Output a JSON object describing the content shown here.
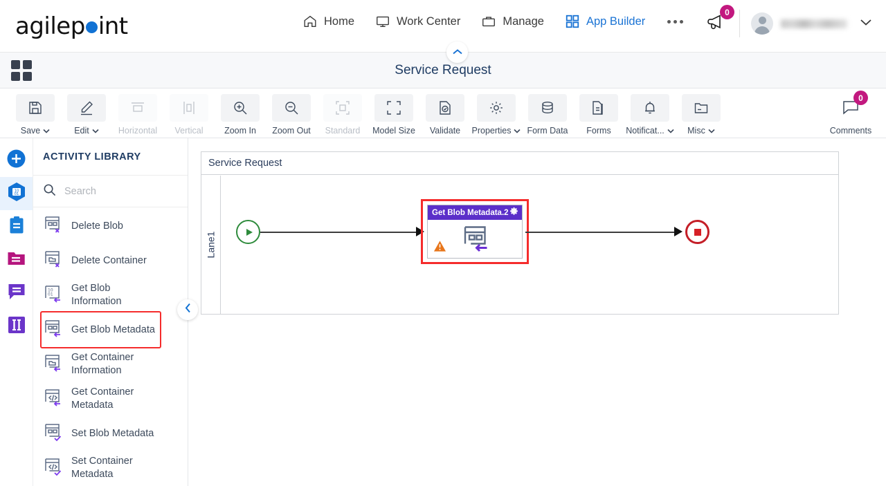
{
  "brand": {
    "name_part1": "agilep",
    "name_part2": "int",
    "dot_color": "#1172d4"
  },
  "topnav": {
    "items": [
      {
        "label": "Home",
        "icon": "home-icon",
        "active": false
      },
      {
        "label": "Work Center",
        "icon": "monitor-icon",
        "active": false
      },
      {
        "label": "Manage",
        "icon": "briefcase-icon",
        "active": false
      },
      {
        "label": "App Builder",
        "icon": "grid-icon",
        "active": true
      }
    ],
    "overflow_icon": "ellipsis-icon",
    "announcements": {
      "icon": "megaphone-icon",
      "badge": "0",
      "badge_color": "#c2187f"
    },
    "user": {
      "avatar": "avatar-icon",
      "name": "",
      "chevron": "chevron-down-icon"
    }
  },
  "titlebar": {
    "apps_icon": "apps-grid-icon",
    "title": "Service Request",
    "collapse_icon": "chevron-up-icon"
  },
  "toolbar": {
    "buttons": [
      {
        "label": "Save",
        "icon": "floppy-disk-icon",
        "caret": true,
        "disabled": false
      },
      {
        "label": "Edit",
        "icon": "pencil-icon",
        "caret": true,
        "disabled": false
      },
      {
        "label": "Horizontal",
        "icon": "align-horizontal-icon",
        "caret": false,
        "disabled": true
      },
      {
        "label": "Vertical",
        "icon": "align-vertical-icon",
        "caret": false,
        "disabled": true
      },
      {
        "label": "Zoom In",
        "icon": "zoom-in-icon",
        "caret": false,
        "disabled": false
      },
      {
        "label": "Zoom Out",
        "icon": "zoom-out-icon",
        "caret": false,
        "disabled": false
      },
      {
        "label": "Standard",
        "icon": "fit-standard-icon",
        "caret": false,
        "disabled": true
      },
      {
        "label": "Model Size",
        "icon": "model-size-icon",
        "caret": false,
        "disabled": false
      },
      {
        "label": "Validate",
        "icon": "validate-check-icon",
        "caret": false,
        "disabled": false
      },
      {
        "label": "Properties",
        "icon": "gear-icon",
        "caret": true,
        "disabled": false
      },
      {
        "label": "Form Data",
        "icon": "database-icon",
        "caret": false,
        "disabled": false
      },
      {
        "label": "Forms",
        "icon": "document-icon",
        "caret": false,
        "disabled": false
      },
      {
        "label": "Notificat...",
        "icon": "bell-icon",
        "caret": true,
        "disabled": false
      },
      {
        "label": "Misc",
        "icon": "folder-card-icon",
        "caret": true,
        "disabled": false
      }
    ],
    "comments": {
      "label": "Comments",
      "icon": "comment-bubble-icon",
      "badge": "0",
      "badge_color": "#c2187f"
    }
  },
  "rail": {
    "items": [
      {
        "name": "add-button",
        "icon": "plus-circle-icon",
        "color": "#1172d4",
        "active": false
      },
      {
        "name": "activities",
        "icon": "hex-data-icon",
        "color": "#1172d4",
        "active": true
      },
      {
        "name": "tasks",
        "icon": "clipboard-icon",
        "color": "#1b80d8",
        "active": false
      },
      {
        "name": "files",
        "icon": "folder-icon",
        "color": "#b5157e",
        "active": false
      },
      {
        "name": "messages",
        "icon": "speech-bubble-icon",
        "color": "#6b35c9",
        "active": false
      },
      {
        "name": "columns",
        "icon": "columns-icon",
        "color": "#6b35c9",
        "active": false
      }
    ]
  },
  "activity_panel": {
    "title": "ACTIVITY LIBRARY",
    "search": {
      "placeholder": "Search",
      "value": "",
      "icon": "search-icon"
    },
    "collapse_icon": "chevron-left-icon",
    "items": [
      {
        "label": "Delete Blob",
        "icon": "blob-delete-icon",
        "highlighted": false
      },
      {
        "label": "Delete Container",
        "icon": "container-delete-icon",
        "highlighted": false
      },
      {
        "label": "Get Blob Information",
        "icon": "blob-info-icon",
        "highlighted": false
      },
      {
        "label": "Get Blob Metadata",
        "icon": "blob-metadata-icon",
        "highlighted": true
      },
      {
        "label": "Get Container Information",
        "icon": "container-info-icon",
        "highlighted": false
      },
      {
        "label": "Get Container Metadata",
        "icon": "container-metadata-icon",
        "highlighted": false
      },
      {
        "label": "Set Blob Metadata",
        "icon": "blob-set-metadata-icon",
        "highlighted": false
      },
      {
        "label": "Set Container Metadata",
        "icon": "container-set-metadata-icon",
        "highlighted": false
      }
    ]
  },
  "canvas": {
    "pool_name": "Service Request",
    "lane_name": "Lane1",
    "start_event": {
      "name": "start-event",
      "color": "#2e8b3c"
    },
    "end_event": {
      "name": "end-event",
      "color": "#c41e27"
    },
    "node": {
      "title": "Get Blob Metadata.2",
      "header_color": "#5b2fc9",
      "gear_icon": "gear-icon",
      "body_icon": "blob-metadata-icon",
      "warning_icon": "warning-triangle-icon",
      "highlight_color": "#f52c2c"
    }
  }
}
